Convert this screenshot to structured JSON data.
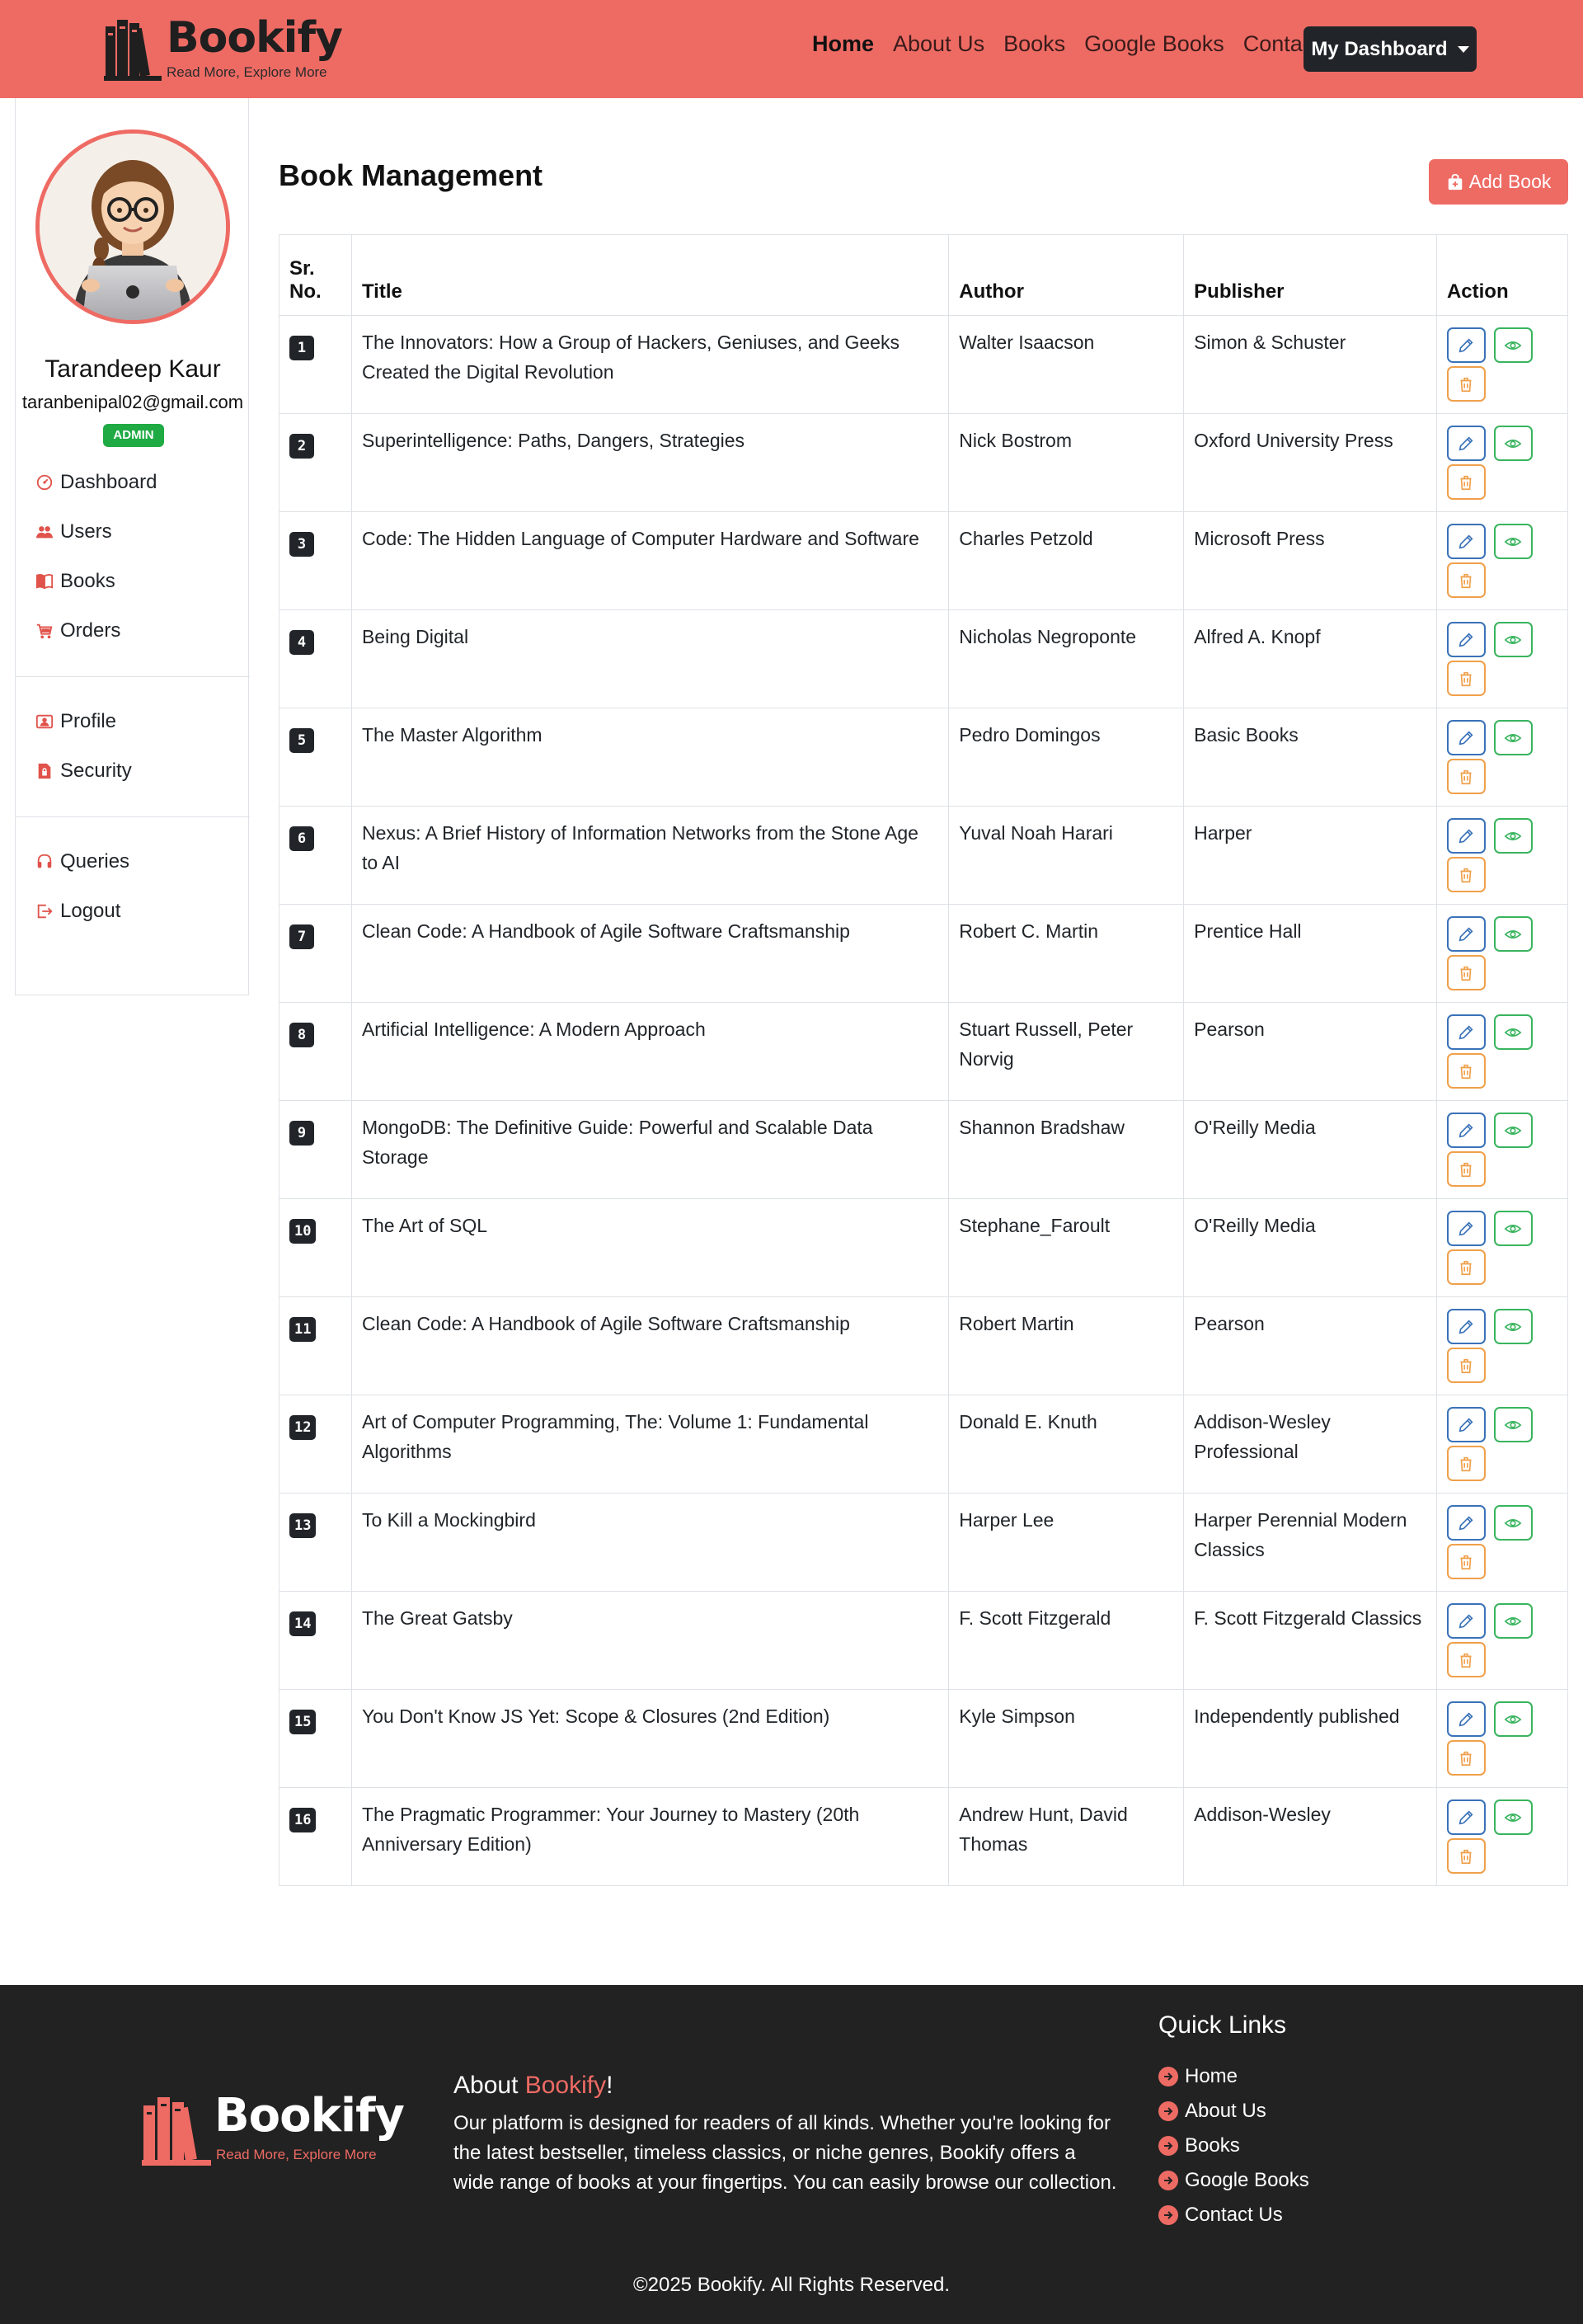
{
  "brand": {
    "name": "Bookify",
    "tagline": "Read More, Explore More"
  },
  "nav": {
    "links": [
      "Home",
      "About Us",
      "Books",
      "Google Books",
      "Contact Us"
    ],
    "active": "Home",
    "dashboard_button": "My Dashboard"
  },
  "sidebar": {
    "user_name": "Tarandeep Kaur",
    "user_email": "taranbenipal02@gmail.com",
    "role": "ADMIN",
    "group1": [
      {
        "label": "Dashboard",
        "icon": "speedometer-icon"
      },
      {
        "label": "Users",
        "icon": "users-icon"
      },
      {
        "label": "Books",
        "icon": "book-icon"
      },
      {
        "label": "Orders",
        "icon": "cart-icon"
      }
    ],
    "group2": [
      {
        "label": "Profile",
        "icon": "person-card-icon"
      },
      {
        "label": "Security",
        "icon": "file-lock-icon"
      }
    ],
    "group3": [
      {
        "label": "Queries",
        "icon": "headset-icon"
      },
      {
        "label": "Logout",
        "icon": "logout-icon"
      }
    ]
  },
  "main": {
    "title": "Book Management",
    "add_button": "Add Book",
    "columns": {
      "sr": "Sr. No.",
      "title": "Title",
      "author": "Author",
      "publisher": "Publisher",
      "action": "Action"
    },
    "rows": [
      {
        "sr": "1",
        "title": "The Innovators: How a Group of Hackers, Geniuses, and Geeks Created the Digital Revolution",
        "author": "Walter Isaacson",
        "publisher": "Simon & Schuster"
      },
      {
        "sr": "2",
        "title": "Superintelligence: Paths, Dangers, Strategies",
        "author": "Nick Bostrom",
        "publisher": "Oxford University Press"
      },
      {
        "sr": "3",
        "title": "Code: The Hidden Language of Computer Hardware and Software",
        "author": "Charles Petzold",
        "publisher": "Microsoft Press"
      },
      {
        "sr": "4",
        "title": "Being Digital",
        "author": "Nicholas Negroponte",
        "publisher": "Alfred A. Knopf"
      },
      {
        "sr": "5",
        "title": "The Master Algorithm",
        "author": "Pedro Domingos",
        "publisher": "Basic Books"
      },
      {
        "sr": "6",
        "title": "Nexus: A Brief History of Information Networks from the Stone Age to AI",
        "author": "Yuval Noah Harari",
        "publisher": "Harper"
      },
      {
        "sr": "7",
        "title": "Clean Code: A Handbook of Agile Software Craftsmanship",
        "author": "Robert C. Martin",
        "publisher": "Prentice Hall"
      },
      {
        "sr": "8",
        "title": "Artificial Intelligence: A Modern Approach",
        "author": "Stuart Russell, Peter Norvig",
        "publisher": "Pearson"
      },
      {
        "sr": "9",
        "title": "MongoDB: The Definitive Guide: Powerful and Scalable Data Storage",
        "author": "Shannon Bradshaw",
        "publisher": "O'Reilly Media"
      },
      {
        "sr": "10",
        "title": "The Art of SQL",
        "author": "Stephane_Faroult",
        "publisher": "O'Reilly Media"
      },
      {
        "sr": "11",
        "title": "Clean Code: A Handbook of Agile Software Craftsmanship",
        "author": "Robert Martin",
        "publisher": "Pearson"
      },
      {
        "sr": "12",
        "title": "Art of Computer Programming, The: Volume 1: Fundamental Algorithms",
        "author": "Donald E. Knuth",
        "publisher": "Addison-Wesley Professional"
      },
      {
        "sr": "13",
        "title": "To Kill a Mockingbird",
        "author": "Harper Lee",
        "publisher": "Harper Perennial Modern Classics"
      },
      {
        "sr": "14",
        "title": "The Great Gatsby",
        "author": "F. Scott Fitzgerald",
        "publisher": "F. Scott Fitzgerald Classics"
      },
      {
        "sr": "15",
        "title": "You Don't Know JS Yet: Scope & Closures (2nd Edition)",
        "author": "Kyle Simpson",
        "publisher": "Independently published"
      },
      {
        "sr": "16",
        "title": "The Pragmatic Programmer: Your Journey to Mastery (20th Anniversary Edition)",
        "author": "Andrew Hunt, David Thomas",
        "publisher": "Addison-Wesley"
      }
    ]
  },
  "footer": {
    "about_prefix": "About ",
    "about_brand": "Bookify",
    "about_suffix": "!",
    "about_text": "Our platform is designed for readers of all kinds. Whether you're looking for the latest bestseller, timeless classics, or niche genres, Bookify offers a wide range of books at your fingertips. You can easily browse our collection.",
    "quick_links_title": "Quick Links",
    "quick_links": [
      "Home",
      "About Us",
      "Books",
      "Google Books",
      "Contact Us"
    ],
    "copyright": "©2025 Bookify. All Rights Reserved."
  },
  "colors": {
    "accent": "#ee6b64",
    "dark": "#212529",
    "footer_bg": "#222222",
    "badge_green": "#1faa44",
    "edit_blue": "#3a72b8",
    "view_green": "#39b45e",
    "delete_orange": "#f0a04b"
  }
}
